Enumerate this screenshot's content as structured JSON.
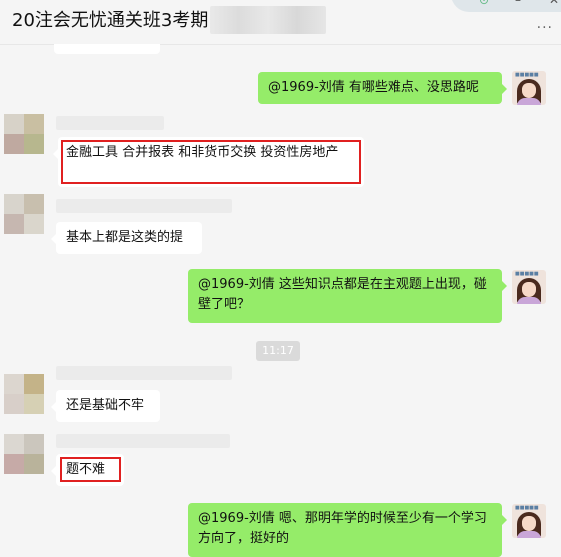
{
  "header": {
    "title": "20注会无忧通关班3考期"
  },
  "window_controls": {
    "minimize": "–",
    "close": "✕",
    "more": "···"
  },
  "chat": {
    "time_divider": "11:17",
    "messages": [
      {
        "id": "m1",
        "side": "out",
        "text": "@1969-刘倩 有哪些难点、没思路呢",
        "highlighted": false
      },
      {
        "id": "m2",
        "side": "in",
        "text": "金融工具 合并报表  和非货币交换   投资性房地产",
        "highlighted": true
      },
      {
        "id": "m3",
        "side": "in",
        "text": "基本上都是这类的提",
        "highlighted": false
      },
      {
        "id": "m4",
        "side": "out",
        "text": "@1969-刘倩 这些知识点都是在主观题上出现，碰壁了吧？",
        "highlighted": false
      },
      {
        "id": "m5",
        "side": "in",
        "text": "还是基础不牢",
        "highlighted": false
      },
      {
        "id": "m6",
        "side": "in",
        "text": "题不难",
        "highlighted": true
      },
      {
        "id": "m7",
        "side": "out",
        "text": "@1969-刘倩 嗯、那明年学的时候至少有一个学习方向了，挺好的",
        "highlighted": false
      }
    ]
  },
  "colors": {
    "outgoing_bubble": "#95ec69",
    "incoming_bubble": "#ffffff",
    "highlight_box": "#e02020",
    "background": "#f5f5f5"
  }
}
